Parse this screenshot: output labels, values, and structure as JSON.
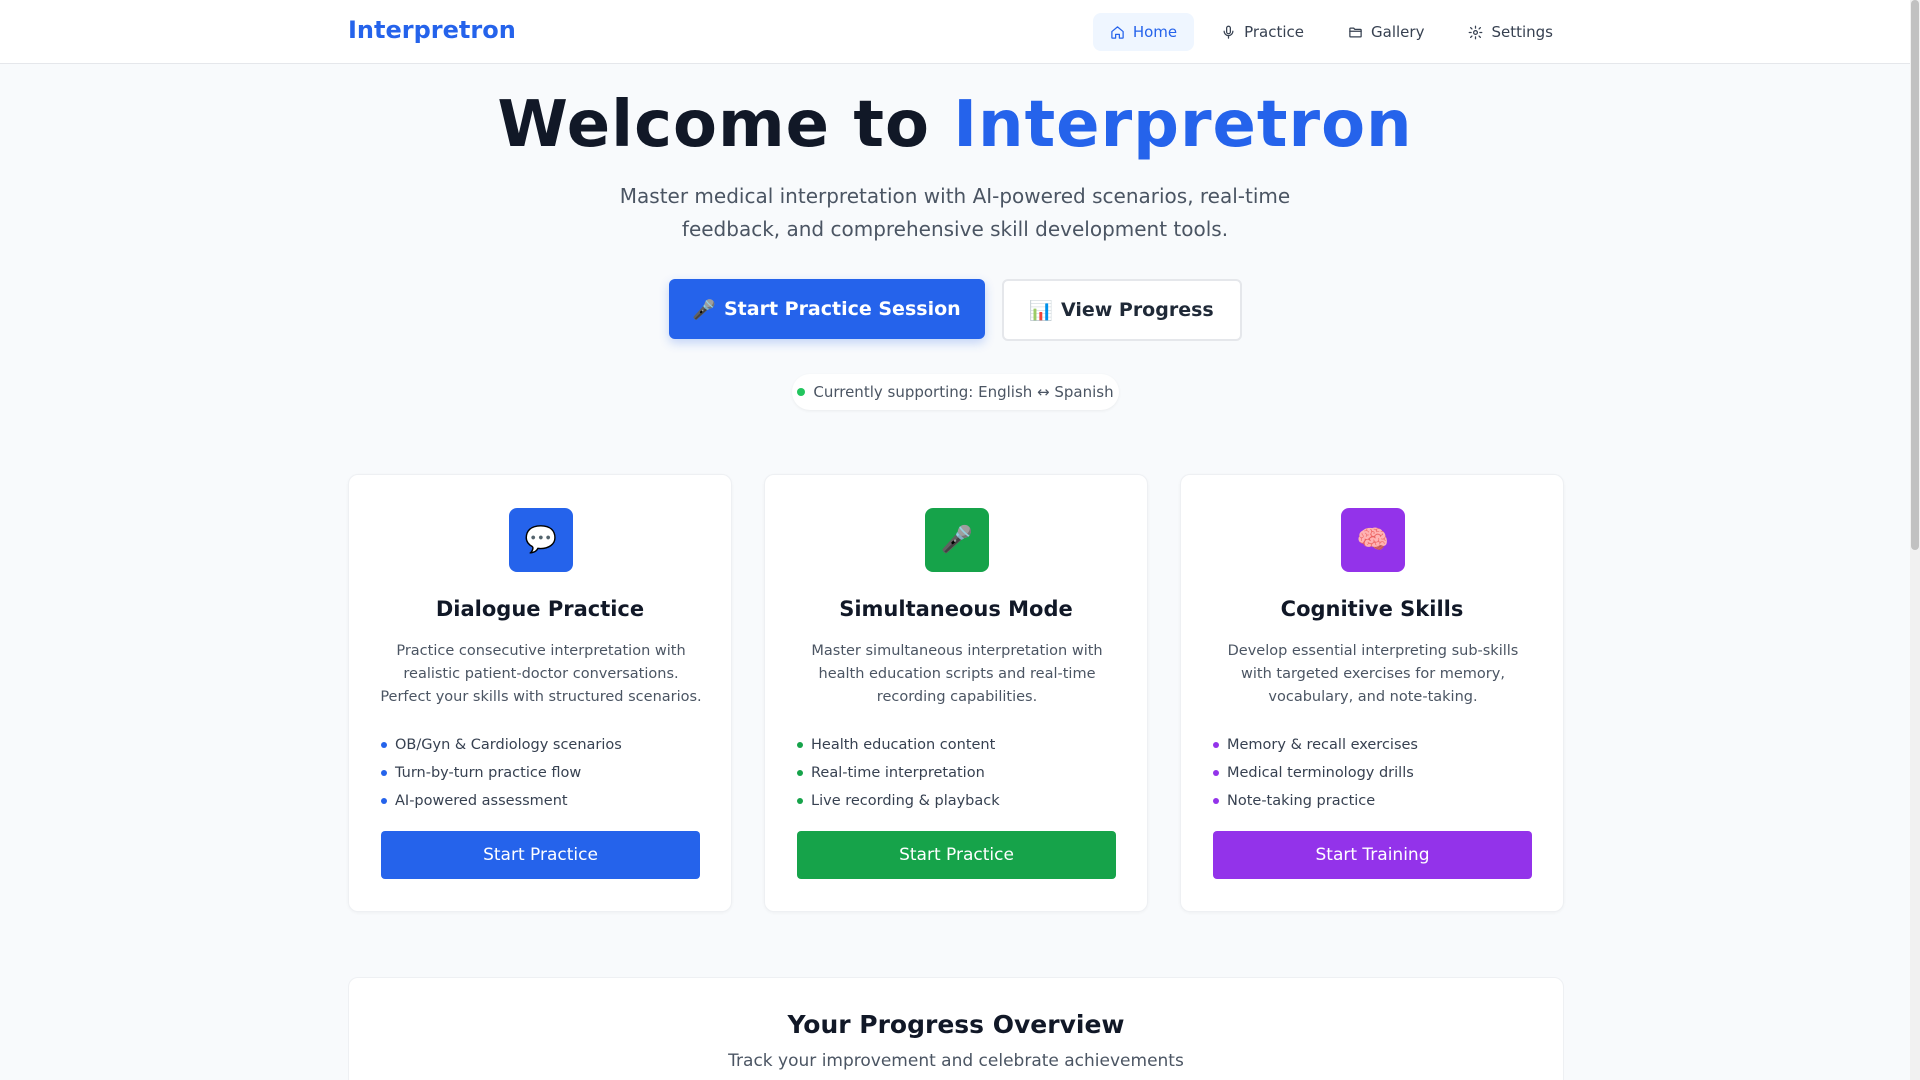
{
  "header": {
    "brand": "Interpretron",
    "nav": [
      {
        "label": "Home",
        "icon": "home-icon",
        "active": true
      },
      {
        "label": "Practice",
        "icon": "microphone-icon",
        "active": false
      },
      {
        "label": "Gallery",
        "icon": "folder-icon",
        "active": false
      },
      {
        "label": "Settings",
        "icon": "gear-icon",
        "active": false
      }
    ]
  },
  "hero": {
    "title_prefix": "Welcome to ",
    "title_accent": "Interpretron",
    "subtitle": "Master medical interpretation with AI-powered scenarios, real-time feedback, and comprehensive skill development tools.",
    "primary_cta": {
      "icon": "🎤",
      "label": "Start Practice Session"
    },
    "secondary_cta": {
      "icon": "📊",
      "label": "View Progress"
    },
    "support_text": "Currently supporting: English ↔ Spanish"
  },
  "cards": [
    {
      "icon": "💬",
      "icon_name": "speech-bubble-icon",
      "color": "#2563eb",
      "title": "Dialogue Practice",
      "description": "Practice consecutive interpretation with realistic patient-doctor conversations. Perfect your skills with structured scenarios.",
      "features": [
        "OB/Gyn & Cardiology scenarios",
        "Turn-by-turn practice flow",
        "AI-powered assessment"
      ],
      "button": "Start Practice"
    },
    {
      "icon": "🎤",
      "icon_name": "microphone-icon",
      "color": "#16a34a",
      "title": "Simultaneous Mode",
      "description": "Master simultaneous interpretation with health education scripts and real-time recording capabilities.",
      "features": [
        "Health education content",
        "Real-time interpretation",
        "Live recording & playback"
      ],
      "button": "Start Practice"
    },
    {
      "icon": "🧠",
      "icon_name": "brain-icon",
      "color": "#9333ea",
      "title": "Cognitive Skills",
      "description": "Develop essential interpreting sub-skills with targeted exercises for memory, vocabulary, and note-taking.",
      "features": [
        "Memory & recall exercises",
        "Medical terminology drills",
        "Note-taking practice"
      ],
      "button": "Start Training"
    }
  ],
  "progress": {
    "title": "Your Progress Overview",
    "subtitle": "Track your improvement and celebrate achievements"
  },
  "colors": {
    "accent": "#2563eb",
    "green": "#16a34a",
    "purple": "#9333ea",
    "status_dot": "#22c55e"
  }
}
